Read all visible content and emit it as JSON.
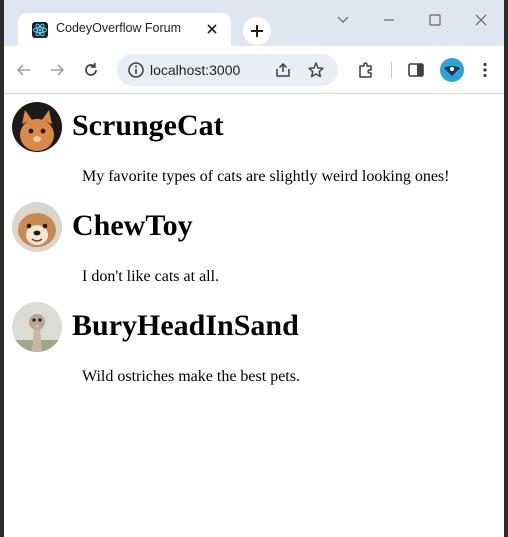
{
  "browser": {
    "tab_title": "CodeyOverflow Forum",
    "url": "localhost:3000"
  },
  "posts": [
    {
      "username": "ScrungeCat",
      "message": "My favorite types of cats are slightly weird looking ones!",
      "avatar": "cat-avatar"
    },
    {
      "username": "ChewToy",
      "message": "I don't like cats at all.",
      "avatar": "dog-avatar"
    },
    {
      "username": "BuryHeadInSand",
      "message": "Wild ostriches make the best pets.",
      "avatar": "ostrich-avatar"
    }
  ],
  "colors": {
    "tabstrip": "#dfe6f2",
    "omnibox": "#e9eef6",
    "profile": "#2fa3d6"
  }
}
